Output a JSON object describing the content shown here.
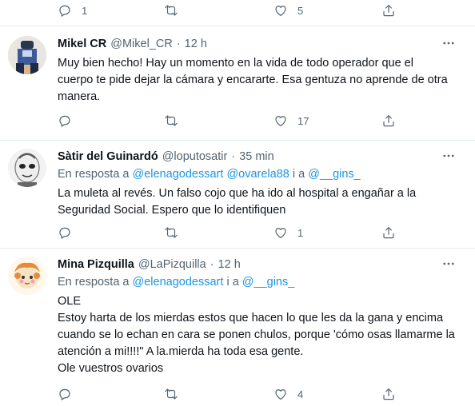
{
  "top_actions": {
    "reply_count": "1",
    "like_count": "5"
  },
  "tweets": [
    {
      "name": "Mikel CR",
      "handle": "@Mikel_CR",
      "separator": "·",
      "time": "12 h",
      "lines": [
        "Muy bien hecho! Hay un momento en la vida de todo operador que el",
        "cuerpo te pide dejar la cámara y encararte. Esa gentuza no aprende de otra",
        "manera."
      ],
      "reply_count": "",
      "like_count": "17"
    },
    {
      "name": "Sàtir del Guinardó",
      "handle": "@loputosatir",
      "separator": "·",
      "time": "35 min",
      "reply_prefix": "En resposta a",
      "reply_users": [
        "@elenagodessart",
        "@ovarela88"
      ],
      "reply_join": "i a",
      "reply_last": "@__gins_",
      "lines": [
        "La muleta al revés. Un falso cojo que ha ido al hospital a engañar a la",
        "Seguridad Social. Espero que lo identifiquen"
      ],
      "reply_count": "",
      "like_count": "1"
    },
    {
      "name": "Mina Pizquilla",
      "handle": "@LaPizquilla",
      "separator": "·",
      "time": "12 h",
      "reply_prefix": "En resposta a",
      "reply_users": [
        "@elenagodessart"
      ],
      "reply_join": "i a",
      "reply_last": "@__gins_",
      "lines": [
        "OLE",
        "Estoy harta de los mierdas estos que hacen lo que les da la gana y encima",
        "cuando se lo echan en cara se ponen chulos, porque 'cómo osas llamarme la",
        "atención a mi!!!!\" A la.mierda ha toda esa gente.",
        "Ole vuestros ovarios"
      ],
      "reply_count": "",
      "like_count": "4"
    }
  ],
  "colors": {
    "link": "#1b95e0",
    "muted": "#536471",
    "divider": "#e6ecf0"
  },
  "icons": [
    "reply-icon",
    "retweet-icon",
    "like-icon",
    "share-icon",
    "more-icon"
  ]
}
